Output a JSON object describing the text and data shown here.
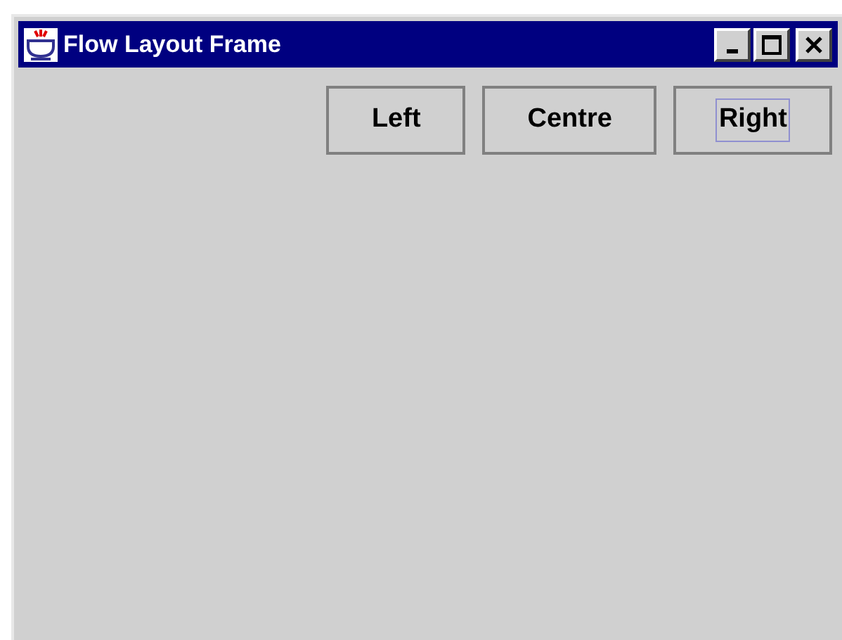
{
  "window": {
    "title": "Flow Layout Frame"
  },
  "buttons": [
    {
      "label": "Left",
      "focused": false
    },
    {
      "label": "Centre",
      "focused": false
    },
    {
      "label": "Right",
      "focused": true
    }
  ]
}
